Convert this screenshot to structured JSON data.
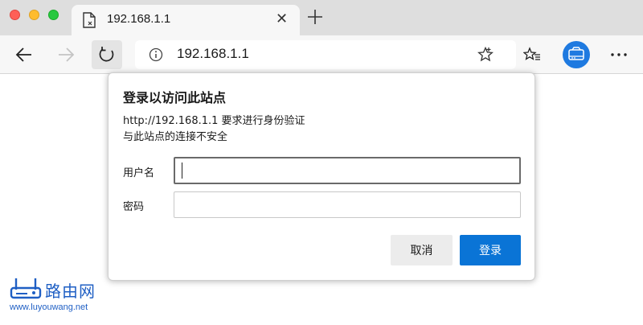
{
  "browser": {
    "tab_title": "192.168.1.1",
    "tab_close_glyph": "✕",
    "address_url": "192.168.1.1",
    "colors": {
      "profile": "#1f7ae0",
      "primary_button": "#0a74d6"
    }
  },
  "dialog": {
    "title": "登录以访问此站点",
    "message_line1": "http://192.168.1.1 要求进行身份验证",
    "message_line2": "与此站点的连接不安全",
    "username_label": "用户名",
    "username_value": "",
    "password_label": "密码",
    "password_value": "",
    "cancel_label": "取消",
    "login_label": "登录"
  },
  "watermark": {
    "brand": "路由网",
    "url": "www.luyouwang.net"
  },
  "icons": {
    "favicon": "page-broken-icon",
    "new_tab": "plus-icon",
    "back": "arrow-left-icon",
    "forward": "arrow-right-icon",
    "reload": "reload-icon",
    "info": "info-icon",
    "favorite": "star-icon",
    "favorites_list": "favorites-list-icon",
    "profile": "profile-icon",
    "more": "more-icon"
  }
}
